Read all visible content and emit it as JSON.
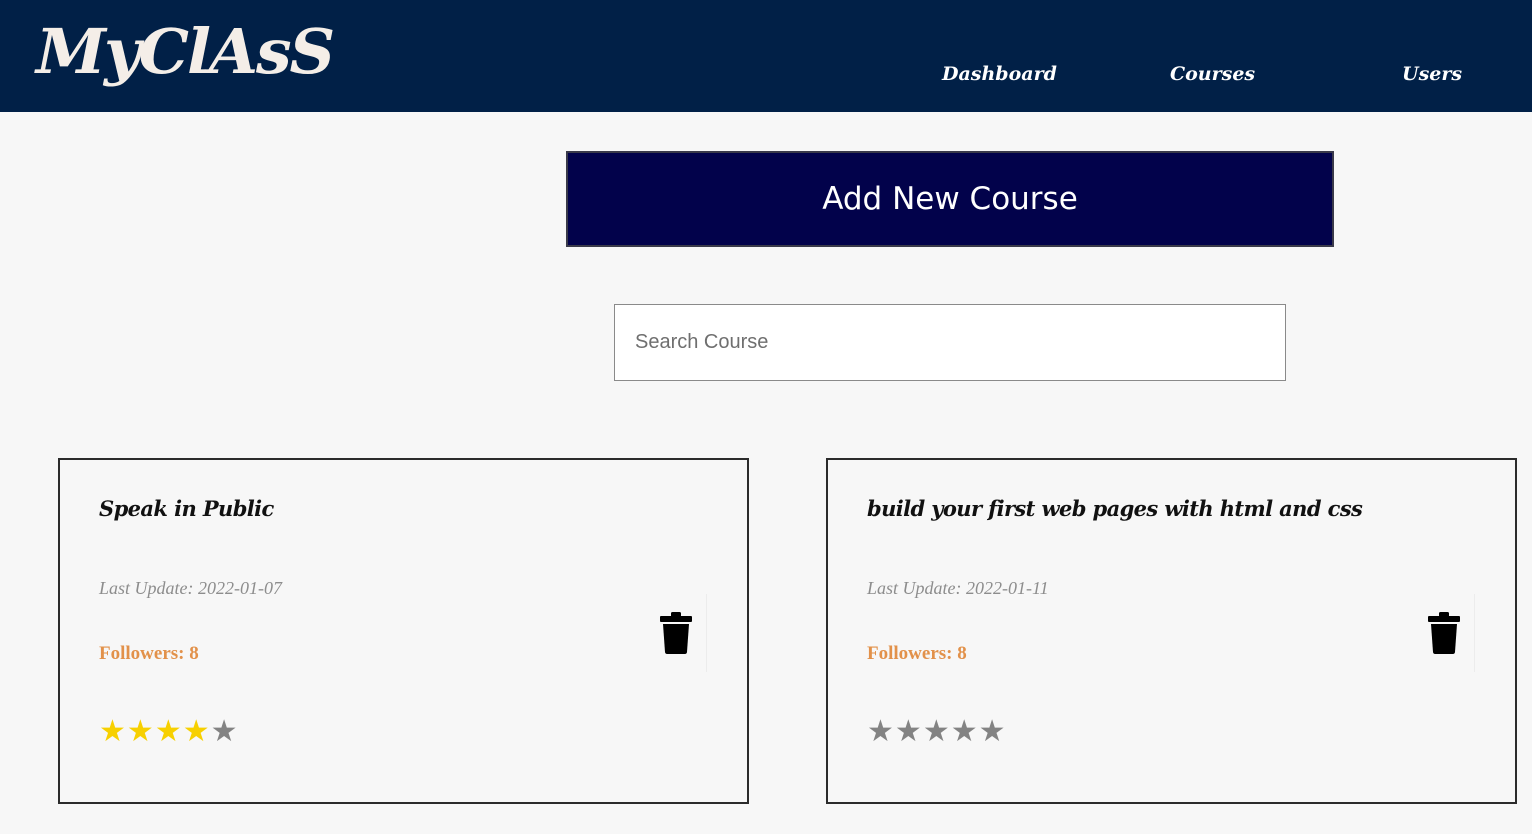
{
  "header": {
    "logo": "MyClAsS",
    "nav": [
      {
        "label": "Dashboard"
      },
      {
        "label": "Courses"
      },
      {
        "label": "Users"
      }
    ]
  },
  "actions": {
    "add_course_label": "Add New Course"
  },
  "search": {
    "placeholder": "Search Course",
    "value": ""
  },
  "courses": [
    {
      "title": "Speak in Public",
      "last_update_label": "Last Update: 2022-01-07",
      "followers_label": "Followers: 8",
      "rating": 4,
      "rating_max": 5
    },
    {
      "title": "build your first web pages with html and css",
      "last_update_label": "Last Update: 2022-01-11",
      "followers_label": "Followers: 8",
      "rating": 0,
      "rating_max": 5
    }
  ],
  "colors": {
    "navbar": "#012047",
    "button": "#02024b",
    "followers": "#e2914a",
    "star_on": "#f7d000",
    "star_off": "#838383"
  },
  "icons": {
    "delete": "trash-icon",
    "star": "star-icon"
  }
}
